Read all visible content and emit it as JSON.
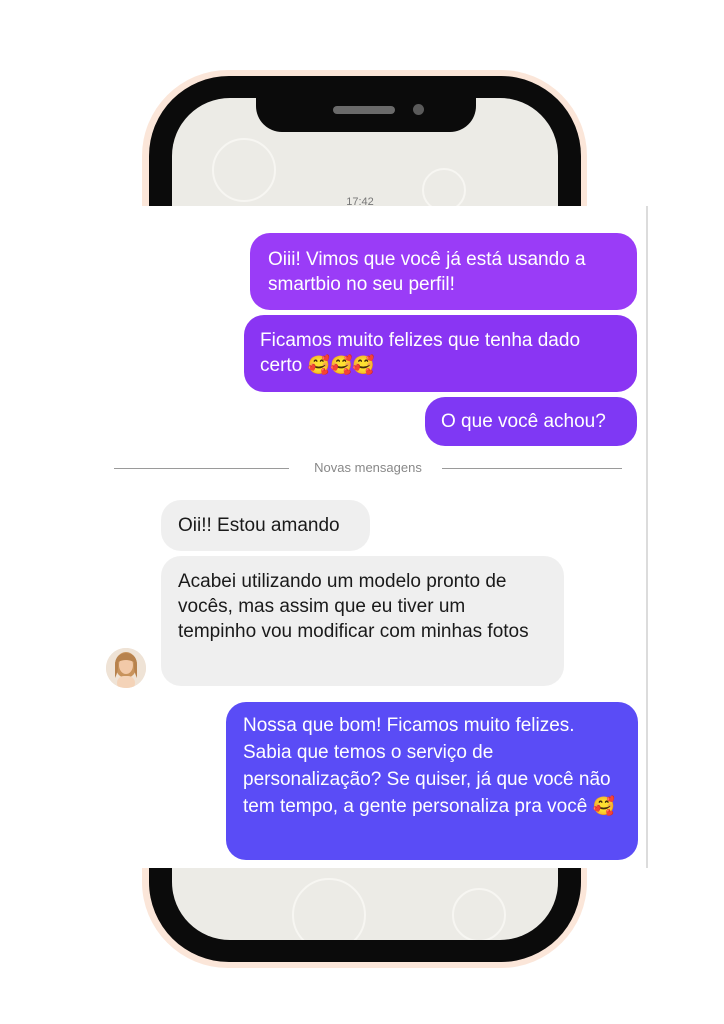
{
  "status": {
    "time": "17:42"
  },
  "chat": {
    "outgoing_top": [
      {
        "text": "Oiii! Vimos que você já está usando a smartbio no seu perfil!"
      },
      {
        "text": "Ficamos muito felizes que tenha dado certo",
        "emoji": "🥰🥰🥰"
      },
      {
        "text": "O que você achou?"
      }
    ],
    "divider_label": "Novas mensagens",
    "incoming": [
      {
        "text": "Oii!! Estou amando"
      },
      {
        "text": "Acabei utilizando um modelo pronto de vocês, mas assim que eu tiver um tempinho vou modificar com minhas fotos"
      }
    ],
    "outgoing_bottom": {
      "text": "Nossa que bom! Ficamos muito felizes. Sabia que temos o serviço de personalização? Se quiser, já que você não tem tempo, a gente personaliza pra você",
      "emoji": "🥰"
    }
  },
  "colors": {
    "bubble_purple_top": "#9a3cf7",
    "bubble_purple_mid": "#8a35f3",
    "bubble_indigo_bottom": "#5a4cf6",
    "incoming_bg": "#efefef",
    "phone_frame": "#0b0b0b",
    "phone_glow": "#fbe6d9"
  },
  "icons": {
    "avatar": "contact-avatar"
  }
}
